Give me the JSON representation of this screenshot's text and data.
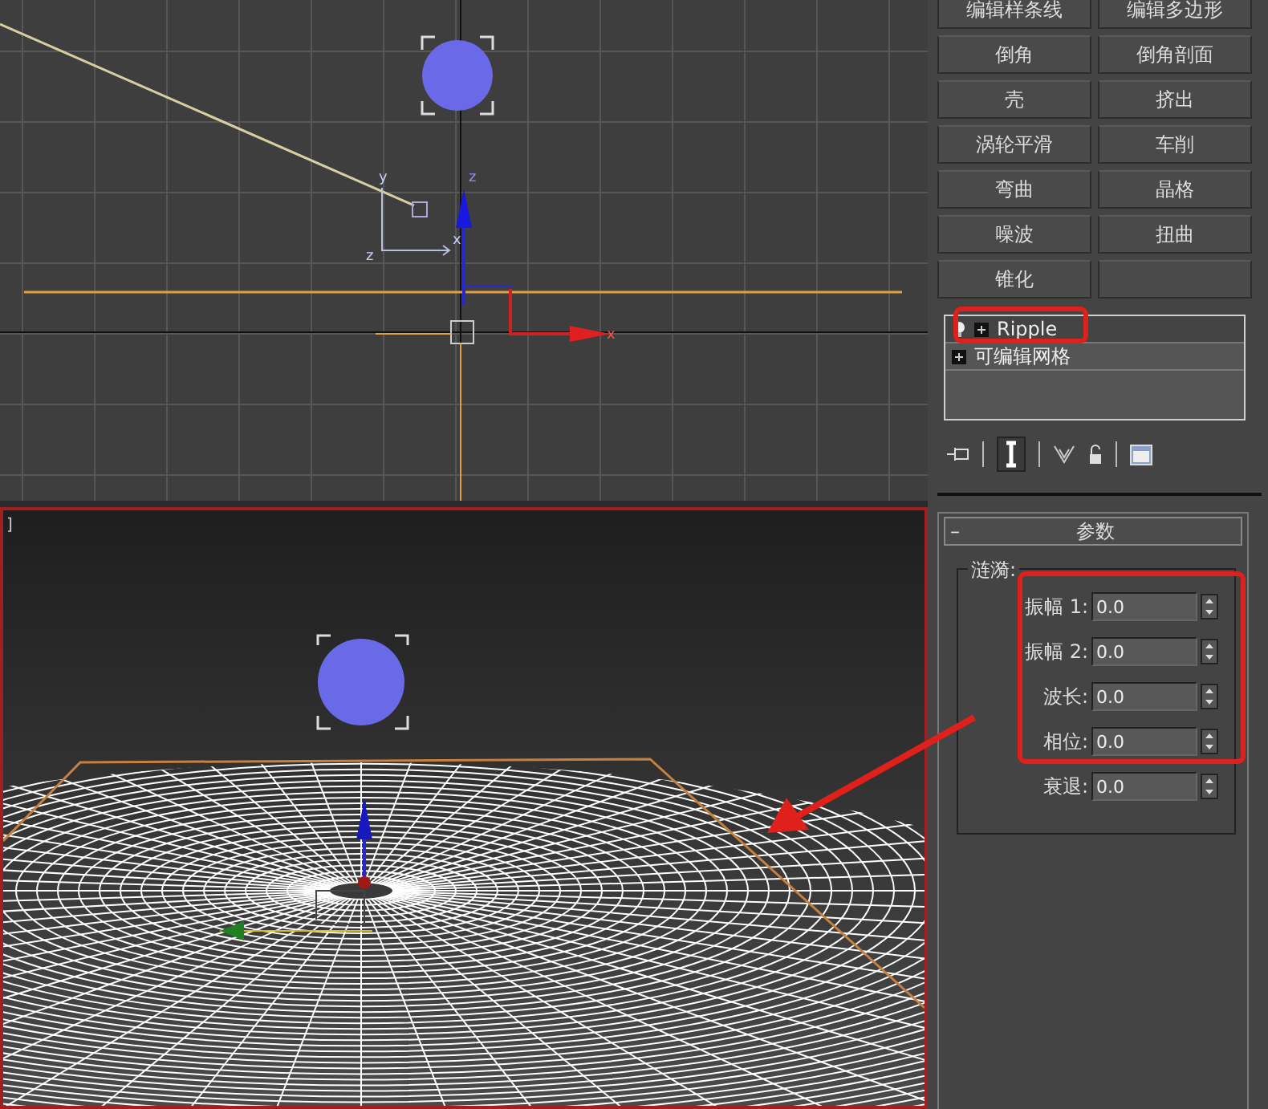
{
  "top_viewport": {
    "gizmo_labels": [
      {
        "kind": "z",
        "text": "z"
      },
      {
        "kind": "x",
        "text": "x"
      }
    ],
    "tripod_labels": [
      {
        "kind": "y",
        "text": "y"
      },
      {
        "kind": "z",
        "text": "z"
      },
      {
        "kind": "x",
        "text": "x"
      }
    ]
  },
  "bottom_viewport": {
    "label": "]",
    "active": true
  },
  "modifier_buttons": [
    {
      "label": "编辑样条线"
    },
    {
      "label": "编辑多边形"
    },
    {
      "label": "倒角"
    },
    {
      "label": "倒角剖面"
    },
    {
      "label": "壳"
    },
    {
      "label": "挤出"
    },
    {
      "label": "涡轮平滑"
    },
    {
      "label": "车削"
    },
    {
      "label": "弯曲"
    },
    {
      "label": "晶格"
    },
    {
      "label": "噪波"
    },
    {
      "label": "扭曲"
    },
    {
      "label": "锥化"
    }
  ],
  "modifier_stack": [
    {
      "kind": "modifier",
      "label": "Ripple"
    },
    {
      "kind": "base",
      "label": "可编辑网格"
    }
  ],
  "parameters": {
    "collapse": "–",
    "title": "参数",
    "group": "涟漪:",
    "fields": [
      {
        "label": "振幅 1:",
        "value": "0.0"
      },
      {
        "label": "振幅 2:",
        "value": "0.0"
      },
      {
        "label": "波长:",
        "value": "0.0"
      },
      {
        "label": "相位:",
        "value": "0.0"
      },
      {
        "label": "衰退:",
        "value": "0.0"
      }
    ]
  }
}
